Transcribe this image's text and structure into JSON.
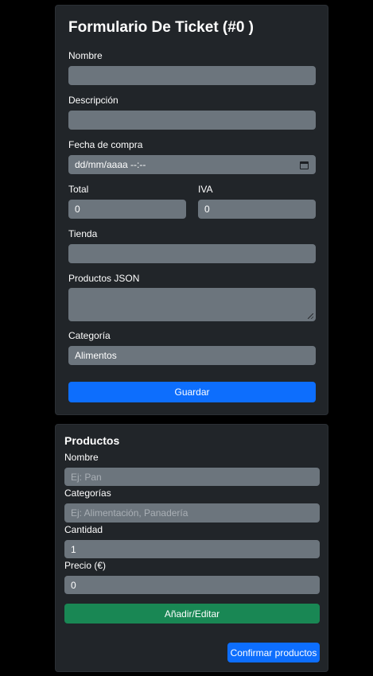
{
  "ticket_form": {
    "title": "Formulario De Ticket (#0 )",
    "nombre_label": "Nombre",
    "nombre_value": "",
    "descripcion_label": "Descripción",
    "descripcion_value": "",
    "fecha_label": "Fecha de compra",
    "fecha_value": "dd/mm/aaaa --:--",
    "total_label": "Total",
    "total_value": "0",
    "iva_label": "IVA",
    "iva_value": "0",
    "tienda_label": "Tienda",
    "tienda_value": "",
    "productos_json_label": "Productos JSON",
    "productos_json_value": "",
    "categoria_label": "Categoría",
    "categoria_value": "Alimentos",
    "save_button": "Guardar"
  },
  "products_form": {
    "title": "Productos",
    "nombre_label": "Nombre",
    "nombre_placeholder": "Ej: Pan",
    "categorias_label": "Categorías",
    "categorias_placeholder": "Ej: Alimentación, Panadería",
    "cantidad_label": "Cantidad",
    "cantidad_value": "1",
    "precio_label": "Precio (€)",
    "precio_value": "0",
    "add_edit_button": "Añadir/Editar",
    "confirm_button": "Confirmar productos"
  },
  "colors": {
    "background": "#000000",
    "card": "#212529",
    "input": "#6c757d",
    "primary": "#0d6efd",
    "success": "#198754"
  }
}
